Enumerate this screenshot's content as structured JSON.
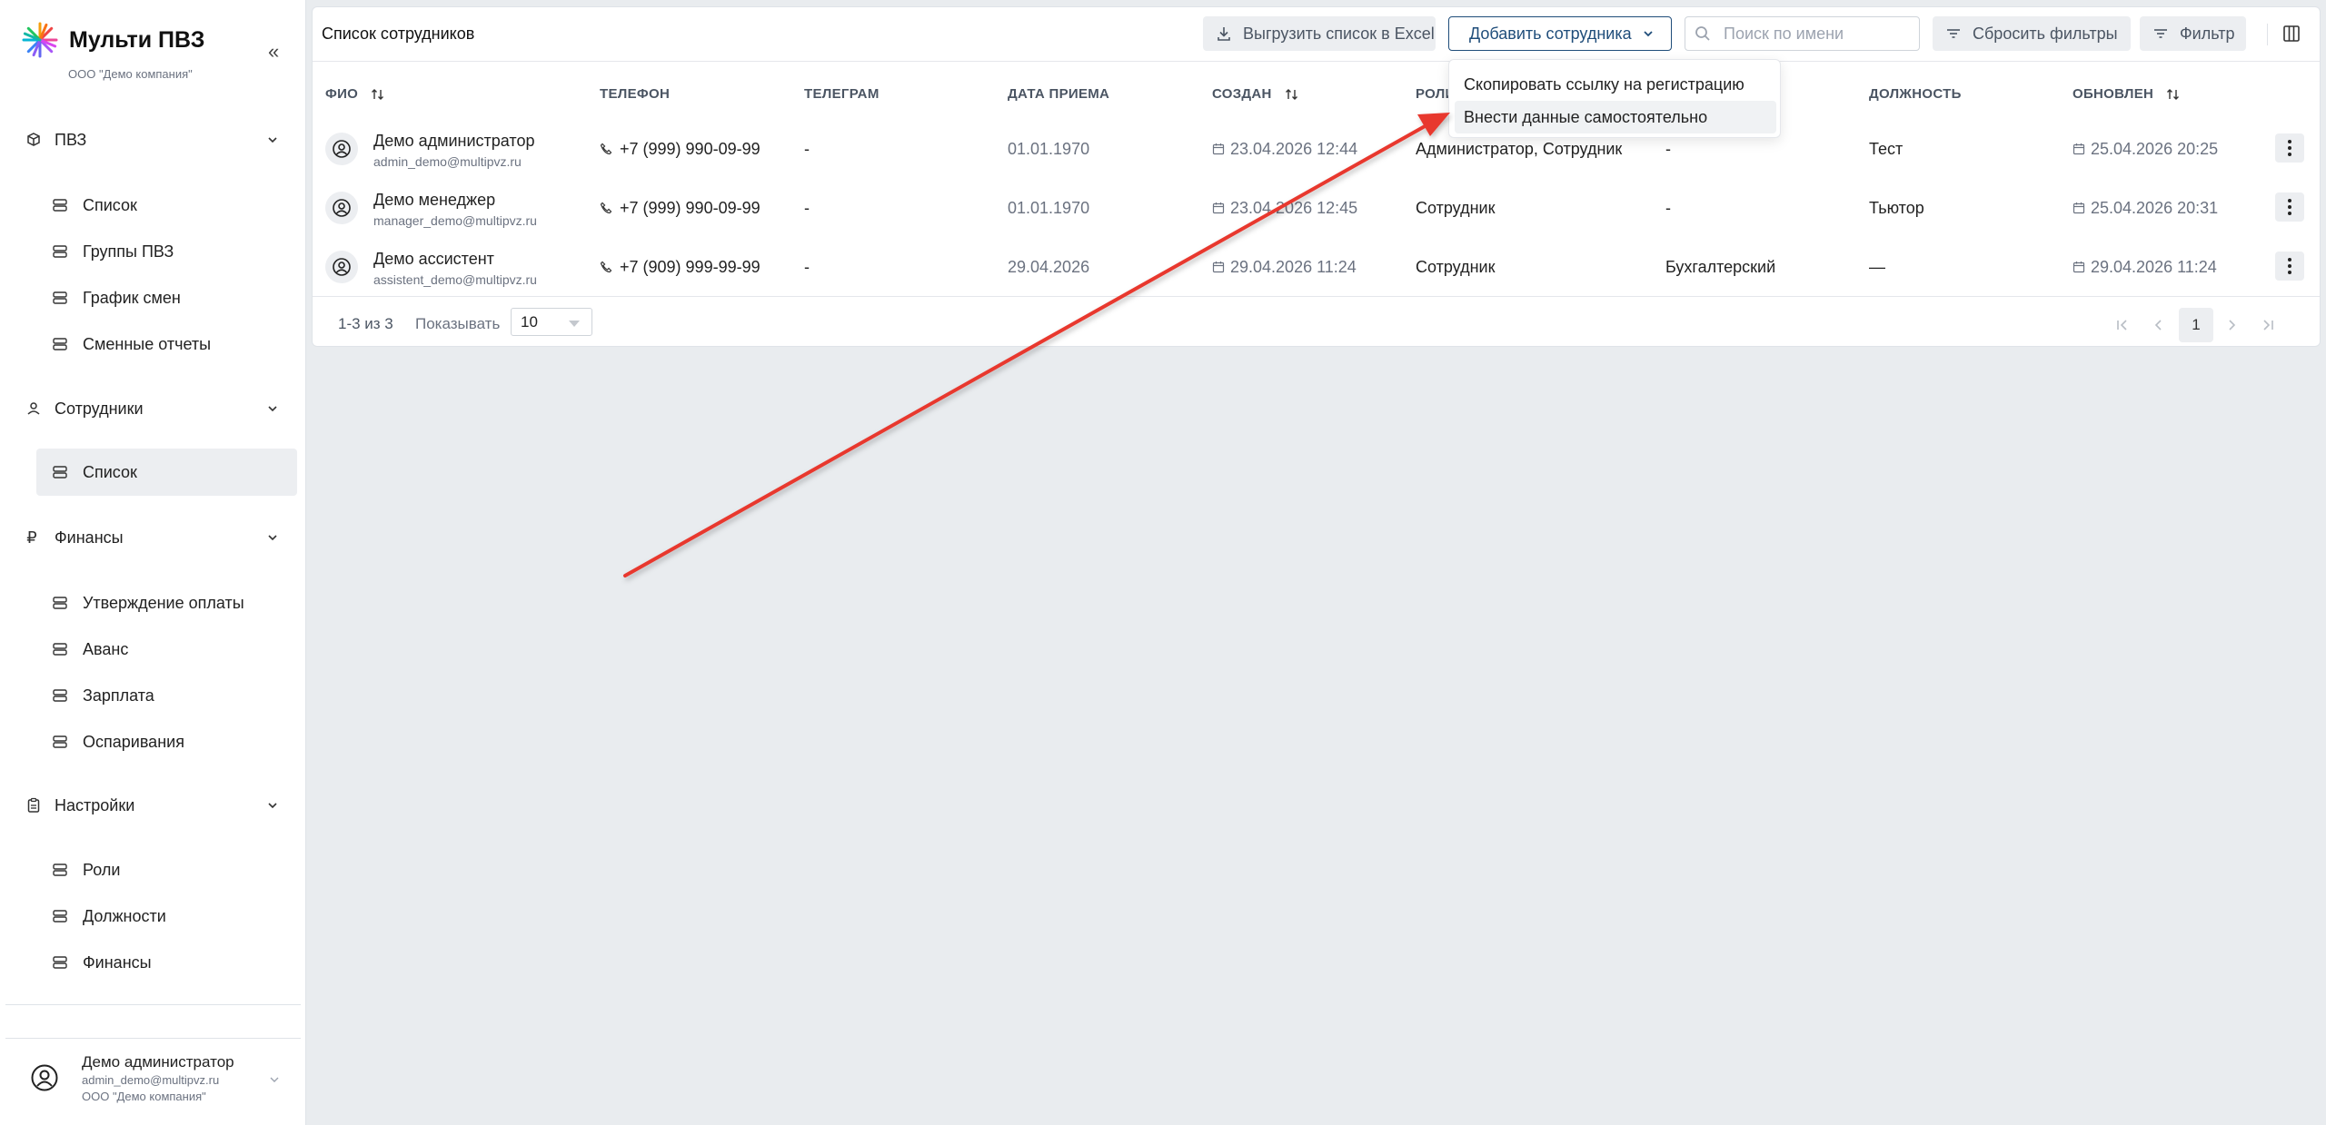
{
  "brand": {
    "title": "Мульти ПВЗ",
    "subtitle": "ООО \"Демо компания\""
  },
  "sidebar": {
    "groups": [
      {
        "label": "ПВЗ",
        "icon": "cube-icon",
        "items": [
          {
            "label": "Список"
          },
          {
            "label": "Группы ПВЗ"
          },
          {
            "label": "График смен"
          },
          {
            "label": "Сменные отчеты"
          }
        ]
      },
      {
        "label": "Сотрудники",
        "icon": "user-icon",
        "items": [
          {
            "label": "Список"
          }
        ]
      },
      {
        "label": "Финансы",
        "icon": "ruble-icon",
        "items": [
          {
            "label": "Утверждение оплаты"
          },
          {
            "label": "Аванс"
          },
          {
            "label": "Зарплата"
          },
          {
            "label": "Оспаривания"
          }
        ]
      },
      {
        "label": "Настройки",
        "icon": "clipboard-icon",
        "items": [
          {
            "label": "Роли"
          },
          {
            "label": "Должности"
          },
          {
            "label": "Финансы"
          }
        ]
      }
    ],
    "user": {
      "name": "Демо администратор",
      "email": "admin_demo@multipvz.ru",
      "org": "ООО \"Демо компания\""
    }
  },
  "main": {
    "title": "Список сотрудников",
    "export_label": "Выгрузить список в Excel",
    "add_label": "Добавить сотрудника",
    "search_placeholder": "Поиск по имени",
    "reset_label": "Сбросить фильтры",
    "filter_label": "Фильтр",
    "columns": [
      "ФИО",
      "ТЕЛЕФОН",
      "ТЕЛЕГРАМ",
      "ДАТА ПРИЕМА",
      "СОЗДАН",
      "РОЛИ",
      "ДОЛЖНОСТЬ",
      "ОБНОВЛЕН"
    ],
    "rows": [
      {
        "name": "Демо администратор",
        "email": "admin_demo@multipvz.ru",
        "phone": "+7 (999) 990-09-99",
        "telegram": "-",
        "hire_date": "01.01.1970",
        "created": "23.04.2026 12:44",
        "roles": "Администратор, Сотрудник",
        "department": "-",
        "position": "Тест",
        "updated": "25.04.2026 20:25"
      },
      {
        "name": "Демо менеджер",
        "email": "manager_demo@multipvz.ru",
        "phone": "+7 (999) 990-09-99",
        "telegram": "-",
        "hire_date": "01.01.1970",
        "created": "23.04.2026 12:45",
        "roles": "Сотрудник",
        "department": "-",
        "position": "Тьютор",
        "updated": "25.04.2026 20:31"
      },
      {
        "name": "Демо ассистент",
        "email": "assistent_demo@multipvz.ru",
        "phone": "+7 (909) 999-99-99",
        "telegram": "-",
        "hire_date": "29.04.2026",
        "created": "29.04.2026 11:24",
        "roles": "Сотрудник",
        "department": "Бухгалтерский",
        "position": "—",
        "updated": "29.04.2026 11:24"
      }
    ],
    "pagination": {
      "range": "1-3 из 3",
      "show_label": "Показывать",
      "page_size": "10",
      "current_page": "1"
    }
  },
  "menu": {
    "items": [
      {
        "label": "Скопировать ссылку на регистрацию"
      },
      {
        "label": "Внести данные самостоятельно"
      }
    ]
  },
  "colors": {
    "accent": "#1f4d7a",
    "arrow": "#e8392f",
    "background": "#e9ecef"
  }
}
